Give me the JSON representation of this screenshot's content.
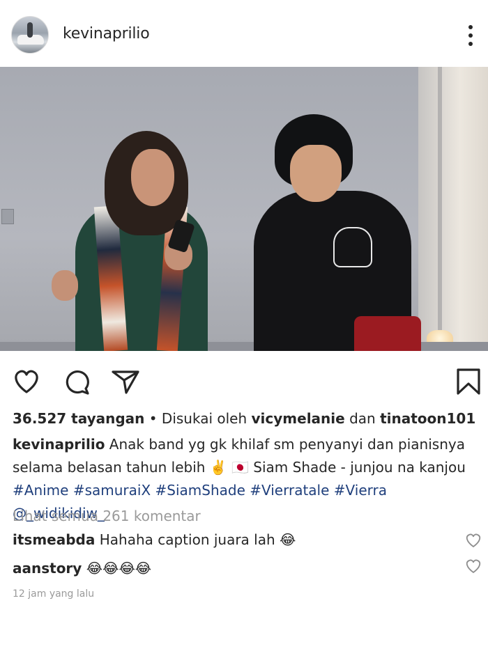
{
  "post": {
    "username": "kevinaprilio",
    "avatar_icon": "profile-photo",
    "more_icon": "more-vertical-icon"
  },
  "actions": {
    "like_icon": "heart-icon",
    "comment_icon": "comment-icon",
    "share_icon": "send-icon",
    "save_icon": "bookmark-icon"
  },
  "stats": {
    "views": "36.527 tayangan",
    "separator": " • Disukai oleh ",
    "liker1": "vicymelanie",
    "and": " dan ",
    "liker2": "tinatoon101"
  },
  "caption": {
    "username": "kevinaprilio",
    "text": " Anak band yg gk khilaf sm penyanyi dan pianisnya selama belasan tahun lebih ✌️ 🇯🇵 Siam Shade - junjou na kanjou ",
    "tags": [
      "#Anime",
      "#samuraiX",
      "#SiamShade",
      "#Vierratale",
      "#Vierra",
      "@_widikidiw_"
    ]
  },
  "comments_link": "Lihat semua 261 komentar",
  "comments": [
    {
      "username": "itsmeabda",
      "text": " Hahaha caption juara lah 😂"
    },
    {
      "username": "aanstory",
      "text": " 😂😂😂😂"
    }
  ],
  "timestamp": "12 jam yang lalu",
  "colors": {
    "text": "#262626",
    "muted": "#9a9a9a",
    "link": "#1f3f7c"
  }
}
